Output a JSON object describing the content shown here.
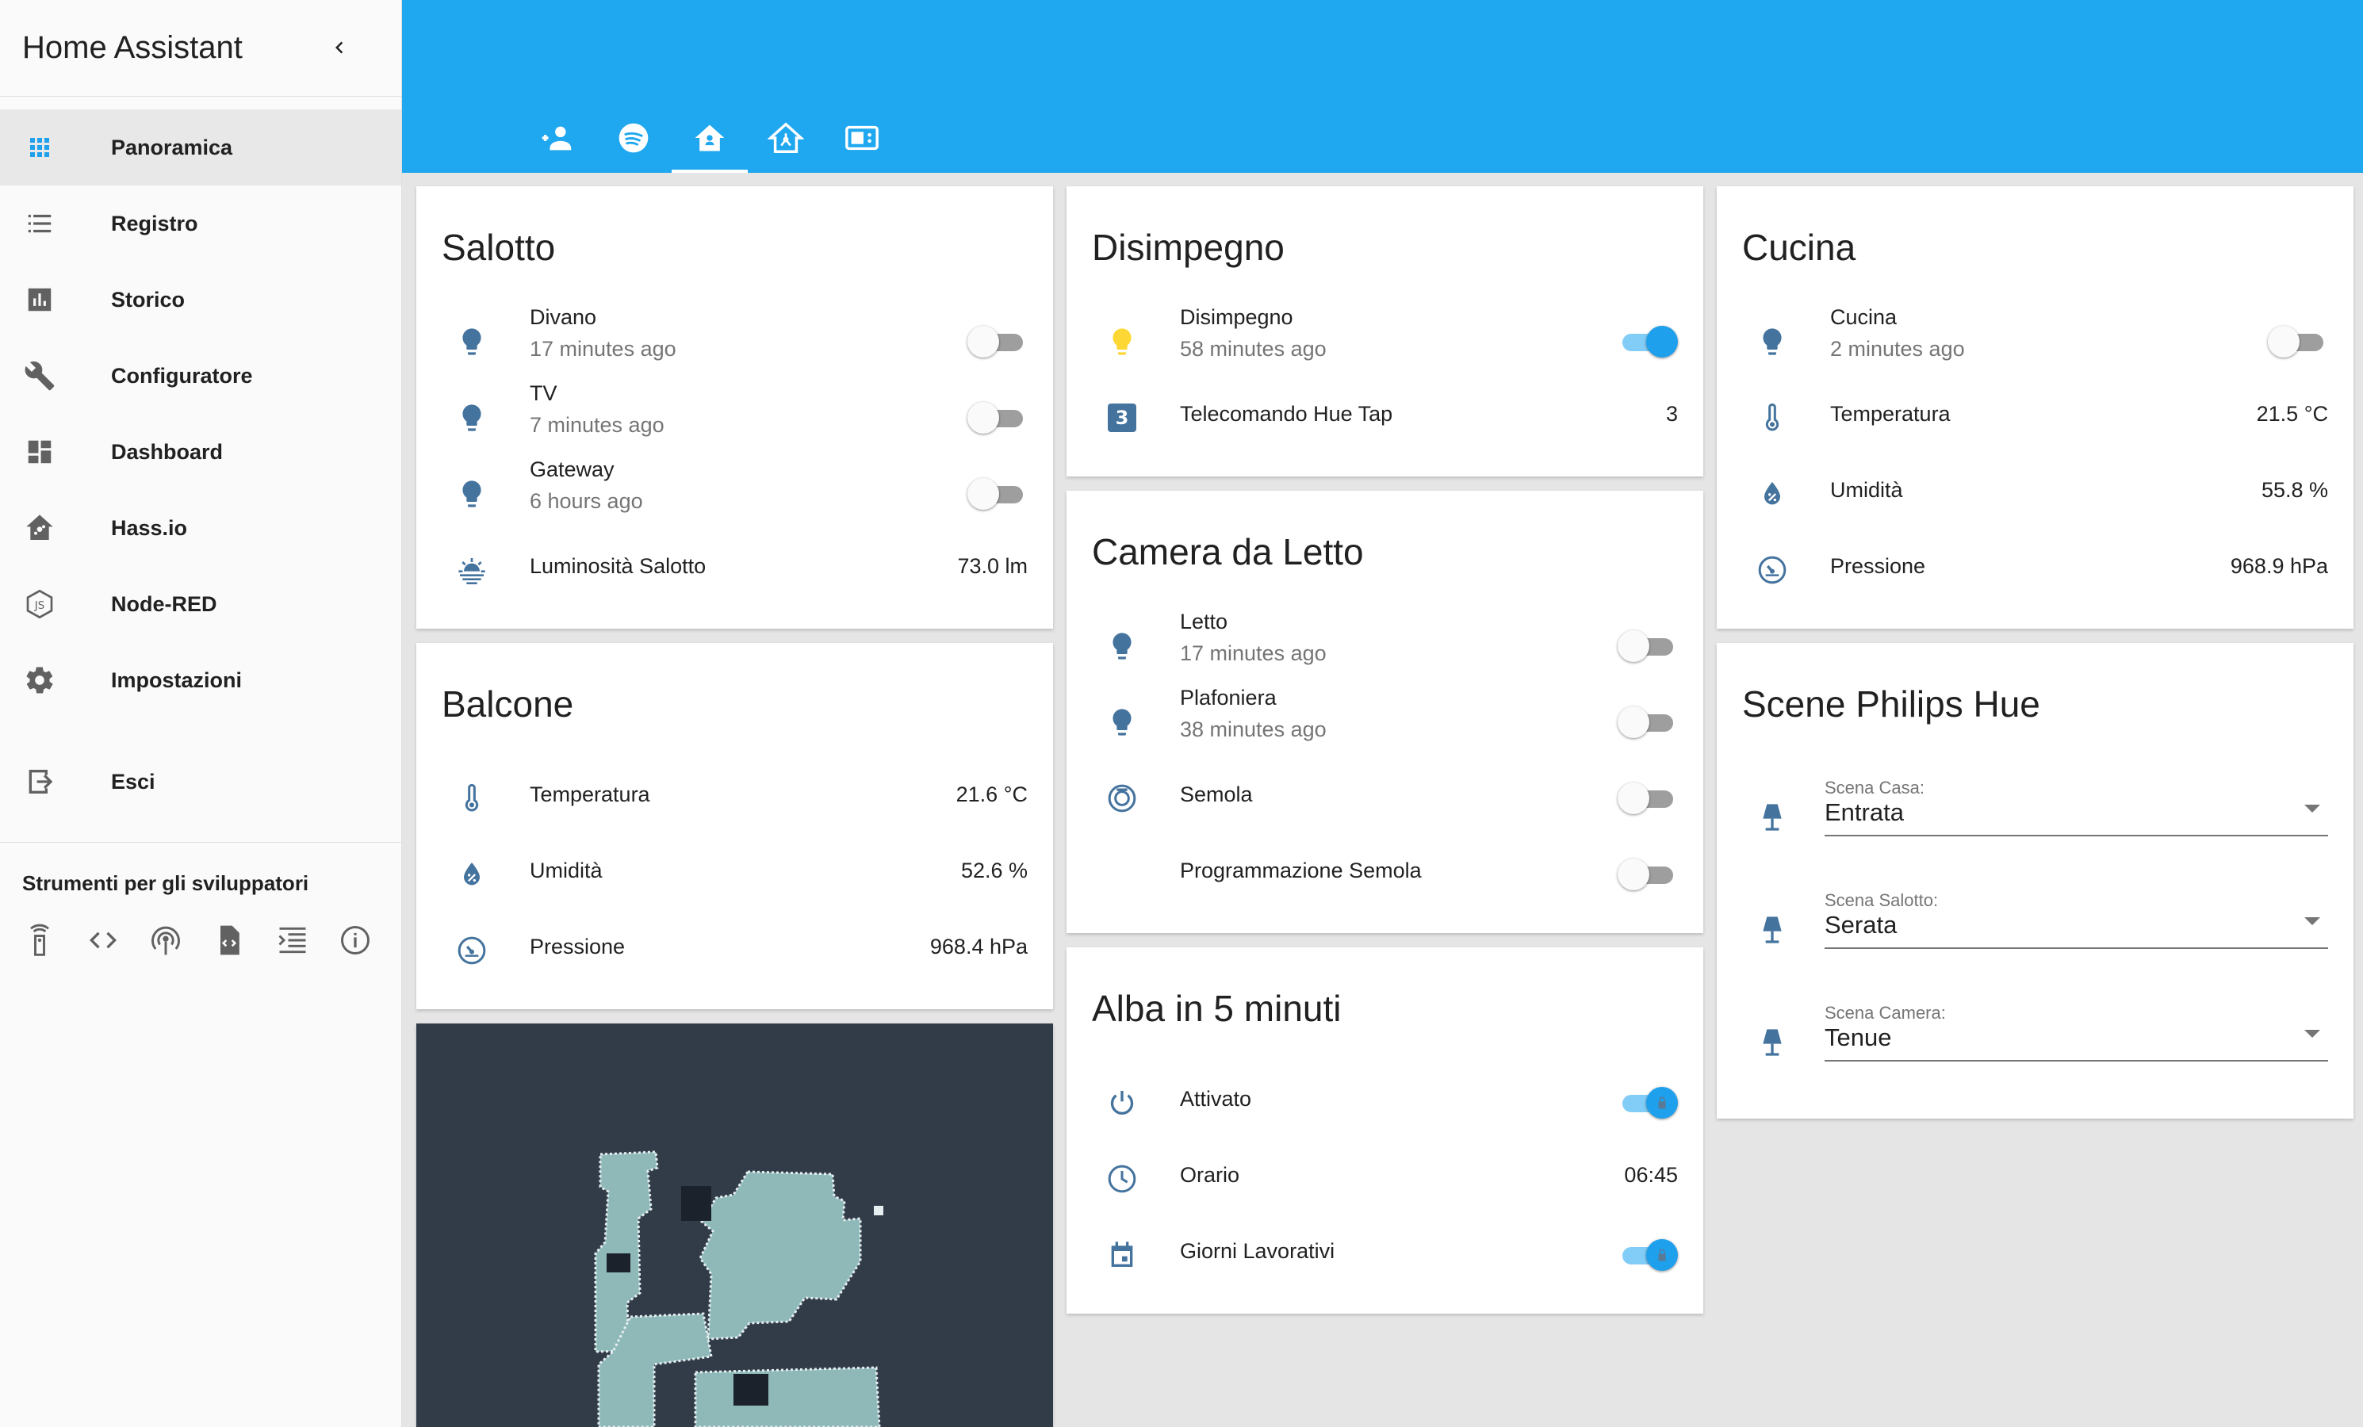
{
  "sidebar": {
    "title": "Home Assistant",
    "items": [
      {
        "label": "Panoramica",
        "icon": "grid-icon",
        "active": true
      },
      {
        "label": "Registro",
        "icon": "list-icon"
      },
      {
        "label": "Storico",
        "icon": "chart-bar-icon"
      },
      {
        "label": "Configuratore",
        "icon": "wrench-icon"
      },
      {
        "label": "Dashboard",
        "icon": "dashboard-icon"
      },
      {
        "label": "Hass.io",
        "icon": "home-assistant-icon"
      },
      {
        "label": "Node-RED",
        "icon": "nodejs-icon"
      },
      {
        "label": "Impostazioni",
        "icon": "gear-icon"
      }
    ],
    "logout": {
      "label": "Esci",
      "icon": "logout-icon"
    },
    "dev_tools_title": "Strumenti per gli sviluppatori",
    "dev_tools": [
      "remote-icon",
      "code-icon",
      "broadcast-icon",
      "template-icon",
      "events-icon",
      "info-icon"
    ]
  },
  "topbar": {
    "tabs": [
      "account-group-icon",
      "spotify-icon",
      "home-icon",
      "home-automation-icon",
      "remote-tv-icon"
    ],
    "active_tab": 2,
    "color": "#1fa7ef"
  },
  "cards": {
    "salotto": {
      "title": "Salotto",
      "rows": [
        {
          "name": "Divano",
          "secondary": "17 minutes ago",
          "state": "off"
        },
        {
          "name": "TV",
          "secondary": "7 minutes ago",
          "state": "off"
        },
        {
          "name": "Gateway",
          "secondary": "6 hours ago",
          "state": "off"
        },
        {
          "name": "Luminosità Salotto",
          "value": "73.0 lm"
        }
      ]
    },
    "balcone": {
      "title": "Balcone",
      "rows": [
        {
          "name": "Temperatura",
          "value": "21.6 °C"
        },
        {
          "name": "Umidità",
          "value": "52.6 %"
        },
        {
          "name": "Pressione",
          "value": "968.4 hPa"
        }
      ]
    },
    "disimpegno": {
      "title": "Disimpegno",
      "rows": [
        {
          "name": "Disimpegno",
          "secondary": "58 minutes ago",
          "state": "on"
        },
        {
          "name": "Telecomando Hue Tap",
          "value": "3",
          "badge": "3"
        }
      ]
    },
    "camera": {
      "title": "Camera da Letto",
      "rows": [
        {
          "name": "Letto",
          "secondary": "17 minutes ago",
          "state": "off"
        },
        {
          "name": "Plafoniera",
          "secondary": "38 minutes ago",
          "state": "off"
        },
        {
          "name": "Semola",
          "state": "off"
        },
        {
          "name": "Programmazione Semola",
          "state": "off"
        }
      ]
    },
    "alba": {
      "title": "Alba in 5 minuti",
      "rows": [
        {
          "name": "Attivato",
          "state": "on"
        },
        {
          "name": "Orario",
          "value": "06:45"
        },
        {
          "name": "Giorni Lavorativi",
          "state": "on"
        }
      ]
    },
    "cucina": {
      "title": "Cucina",
      "rows": [
        {
          "name": "Cucina",
          "secondary": "2 minutes ago",
          "state": "off"
        },
        {
          "name": "Temperatura",
          "value": "21.5 °C"
        },
        {
          "name": "Umidità",
          "value": "55.8 %"
        },
        {
          "name": "Pressione",
          "value": "968.9 hPa"
        }
      ]
    },
    "scene": {
      "title": "Scene Philips Hue",
      "selects": [
        {
          "label": "Scena Casa:",
          "value": "Entrata"
        },
        {
          "label": "Scena Salotto:",
          "value": "Serata"
        },
        {
          "label": "Scena Camera:",
          "value": "Tenue"
        }
      ]
    }
  },
  "colors": {
    "accent": "#1fa0ec",
    "icon": "#44739e",
    "light_on": "#fdd835",
    "map_bg": "#323c49",
    "map_floor": "#8fb8b8"
  }
}
